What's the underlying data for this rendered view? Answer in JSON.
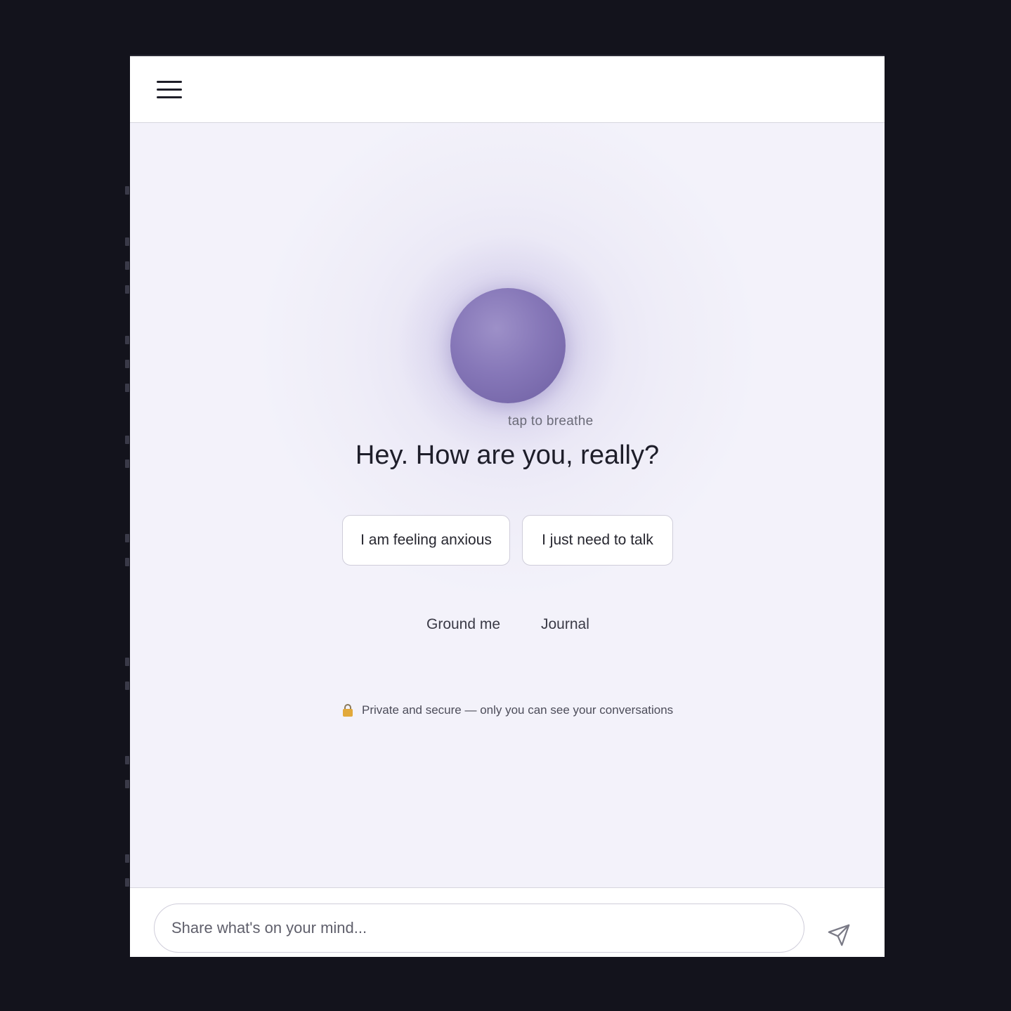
{
  "app": {
    "menu_icon": "hamburger-menu-icon"
  },
  "main": {
    "orb_hint": "tap to breathe",
    "headline": "Hey. How are you, really?",
    "quick_replies": [
      {
        "label": "I am feeling anxious"
      },
      {
        "label": "I just need to talk"
      }
    ],
    "links": [
      {
        "label": "Ground me"
      },
      {
        "label": "Journal"
      }
    ],
    "privacy_note": "Private and secure — only you can see your conversations",
    "privacy_icon": "lock-icon"
  },
  "composer": {
    "placeholder": "Share what's on your mind...",
    "send_icon": "send-icon"
  },
  "colors": {
    "page_background": "#f3f2fa",
    "orb": "#8677b8",
    "outer_background": "#13131c"
  }
}
